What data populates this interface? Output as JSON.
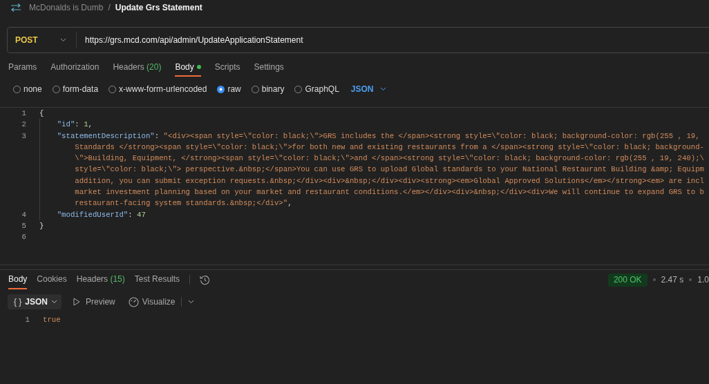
{
  "breadcrumb": {
    "collection": "McDonalds is Dumb",
    "separator": "/",
    "request": "Update Grs Statement"
  },
  "request": {
    "method": "POST",
    "url": "https://grs.mcd.com/api/admin/UpdateApplicationStatement"
  },
  "request_tabs": [
    {
      "label": "Params",
      "selected": false,
      "modified": false
    },
    {
      "label": "Authorization",
      "selected": false,
      "modified": false
    },
    {
      "label": "Headers",
      "count": "(20)",
      "selected": false,
      "modified": false
    },
    {
      "label": "Body",
      "selected": true,
      "modified": true
    },
    {
      "label": "Scripts",
      "selected": false,
      "modified": false
    },
    {
      "label": "Settings",
      "selected": false,
      "modified": false
    }
  ],
  "body_types": [
    {
      "label": "none",
      "selected": false
    },
    {
      "label": "form-data",
      "selected": false
    },
    {
      "label": "x-www-form-urlencoded",
      "selected": false
    },
    {
      "label": "raw",
      "selected": true
    },
    {
      "label": "binary",
      "selected": false
    },
    {
      "label": "GraphQL",
      "selected": false
    }
  ],
  "raw_format": "JSON",
  "editor": {
    "lines": [
      {
        "number": "1",
        "rows": [
          {
            "tokens": [
              {
                "kind": "punct",
                "text": "{"
              }
            ]
          }
        ],
        "children": [
          {
            "number": "2",
            "rows": [
              {
                "tokens": [
                  {
                    "kind": "key",
                    "text": "\"id\""
                  },
                  {
                    "kind": "punct",
                    "text": ": "
                  },
                  {
                    "kind": "number",
                    "text": "1"
                  },
                  {
                    "kind": "punct",
                    "text": ","
                  }
                ]
              }
            ]
          },
          {
            "number": "3",
            "rows": [
              {
                "tokens": [
                  {
                    "kind": "key",
                    "text": "\"statementDescription\""
                  },
                  {
                    "kind": "punct",
                    "text": ": "
                  },
                  {
                    "kind": "string",
                    "text": "\"<div><span style=\\\"color: black;\\\">GRS includes the </span><strong style=\\\"color: black; background-color: rgb(255 , 19,"
                  }
                ]
              },
              {
                "tokens": [
                  {
                    "kind": "string",
                    "text": "Standards </strong><span style=\\\"color: black;\\\">for both new and existing restaurants from a </span><strong style=\\\"color: black; background-"
                  }
                ]
              },
              {
                "tokens": [
                  {
                    "kind": "string",
                    "text": "\\\">Building, Equipment, </strong><span style=\\\"color: black;\\\">and </span><strong style=\\\"color: black; background-color: rgb(255 , 19, 240);\\"
                  }
                ]
              },
              {
                "tokens": [
                  {
                    "kind": "string",
                    "text": "style=\\\"color: black;\\\"> perspective.&nbsp;</span>You can use GRS to upload Global standards to your National Restaurant Building &amp; Equipm"
                  }
                ]
              },
              {
                "tokens": [
                  {
                    "kind": "string",
                    "text": "addition, you can submit exception requests.&nbsp;</div><div>&nbsp;</div><div><strong><em>Global Approved Solutions</em></strong><em> are incl"
                  }
                ]
              },
              {
                "tokens": [
                  {
                    "kind": "string",
                    "text": "market investment planning based on your market and restaurant conditions.</em></div><div>&nbsp;</div><div>We will continue to expand GRS to b"
                  }
                ]
              },
              {
                "tokens": [
                  {
                    "kind": "string",
                    "text": "restaurant-facing system standards.&nbsp;</div>\""
                  },
                  {
                    "kind": "punct",
                    "text": ","
                  }
                ]
              }
            ]
          },
          {
            "number": "4",
            "rows": [
              {
                "tokens": [
                  {
                    "kind": "key",
                    "text": "\"modifiedUserId\""
                  },
                  {
                    "kind": "punct",
                    "text": ": "
                  },
                  {
                    "kind": "number",
                    "text": "47"
                  }
                ]
              }
            ]
          }
        ]
      },
      {
        "number": "5",
        "rows": [
          {
            "tokens": [
              {
                "kind": "punct",
                "text": "}"
              }
            ]
          }
        ]
      },
      {
        "number": "6"
      }
    ]
  },
  "response": {
    "tabs": [
      {
        "label": "Body",
        "selected": true
      },
      {
        "label": "Cookies",
        "selected": false
      },
      {
        "label": "Headers",
        "count": "(15)",
        "selected": false
      },
      {
        "label": "Test Results",
        "selected": false
      }
    ],
    "status": "200 OK",
    "time": "2.47 s",
    "size": "1.0",
    "view_format": {
      "glyph": "{ }",
      "label": "JSON"
    },
    "view_options": [
      {
        "kind": "preview",
        "label": "Preview"
      },
      {
        "kind": "visualize",
        "label": "Visualize"
      }
    ],
    "lines": [
      {
        "number": "1",
        "rows": [
          {
            "tokens": [
              {
                "kind": "literal",
                "text": "true"
              }
            ]
          }
        ]
      }
    ]
  }
}
